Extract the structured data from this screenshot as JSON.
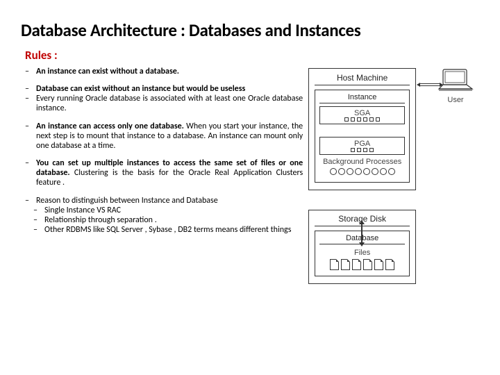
{
  "title": "Database Architecture : Databases and Instances",
  "subtitle": "Rules :",
  "rules": [
    {
      "text": "An instance can exist without a database.",
      "bold": true
    },
    {
      "text": "Database can exist  without an instance but would be useless",
      "bold": true
    },
    {
      "text": "Every running Oracle database is associated with at least one Oracle database instance."
    },
    {
      "boldPart": "An instance can access only one database.",
      "rest": " When you start your instance, the next step is to mount that instance to a database. An instance can mount only one database at a time."
    },
    {
      "boldPart": "You can set up multiple instances to access the same set of files or one database.",
      "rest": " Clustering is the basis for the Oracle Real Application Clusters  feature ."
    },
    {
      "text": "Reason to distinguish between  Instance and Database"
    },
    {
      "text": " Single Instance VS  RAC",
      "sub": true
    },
    {
      "text": " Relationship through separation .",
      "sub": true
    },
    {
      "text": " Other RDBMS like SQL Server , Sybase , DB2   terms means different things",
      "sub": true
    }
  ],
  "diagram": {
    "hostMachine": "Host Machine",
    "instance": "Instance",
    "sga": "SGA",
    "pga": "PGA",
    "bgProcs": "Background\nProcesses",
    "storageDisk": "Storage Disk",
    "database": "Database",
    "files": "Files",
    "user": "User"
  }
}
